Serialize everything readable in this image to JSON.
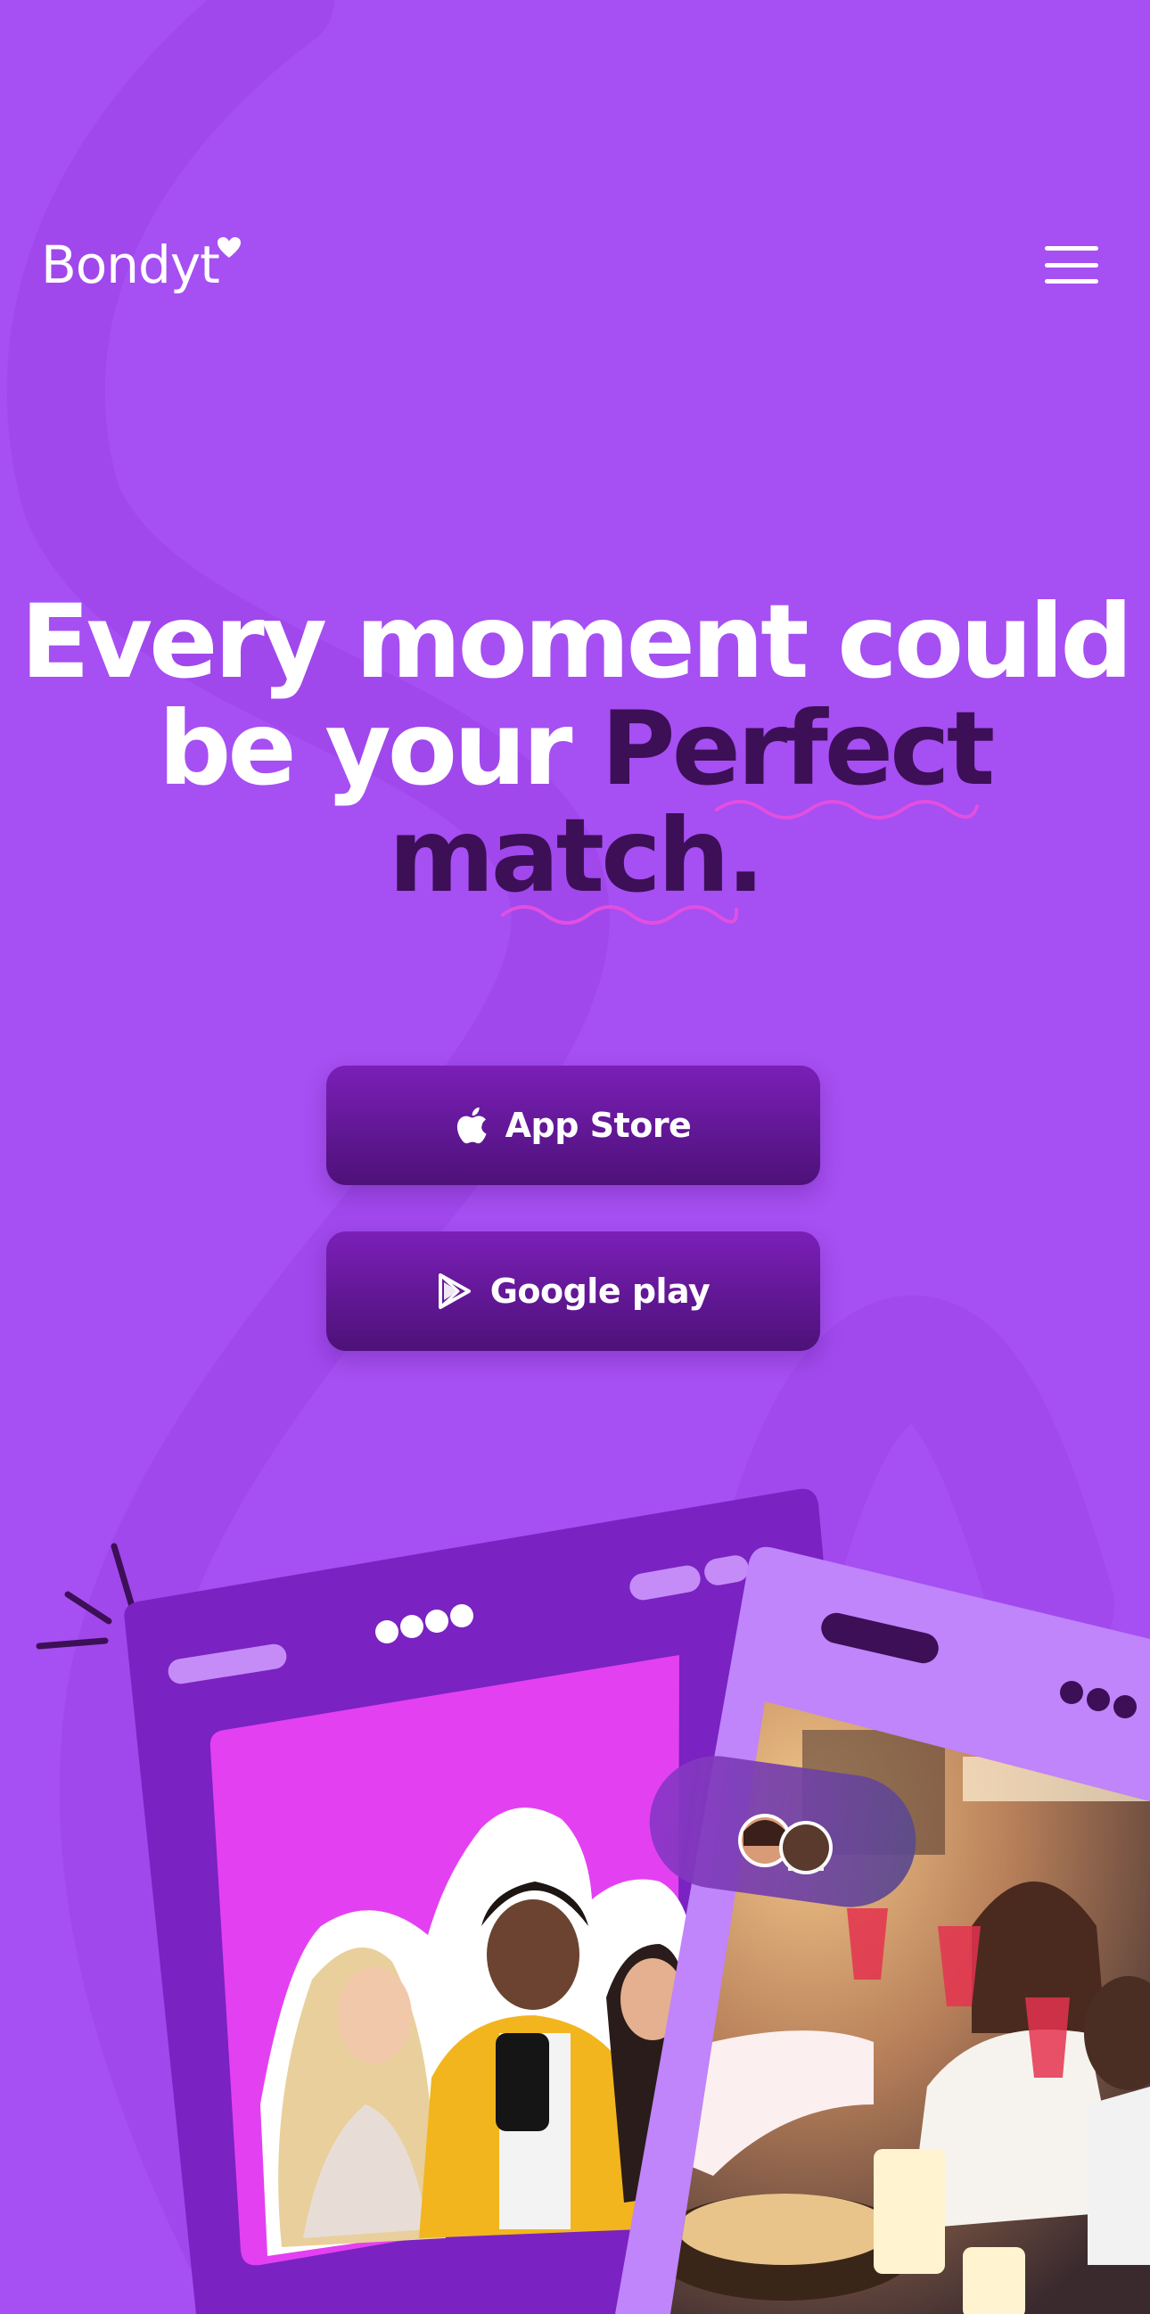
{
  "header": {
    "logo_text": "Bondyt",
    "logo_icon": "heart-icon",
    "menu_icon": "hamburger-menu-icon"
  },
  "hero": {
    "line1": "Every moment could",
    "line2_plain": "be your ",
    "line2_accent": "Perfect",
    "line3_accent": "match."
  },
  "buttons": {
    "app_store": {
      "label": "App Store",
      "icon": "apple-icon"
    },
    "google_play": {
      "label": "Google play",
      "icon": "play-store-icon"
    }
  },
  "colors": {
    "background": "#a64ff2",
    "accent_text": "#3d0f57",
    "button": "#6a17a3",
    "squiggle": "#e24fe0"
  }
}
